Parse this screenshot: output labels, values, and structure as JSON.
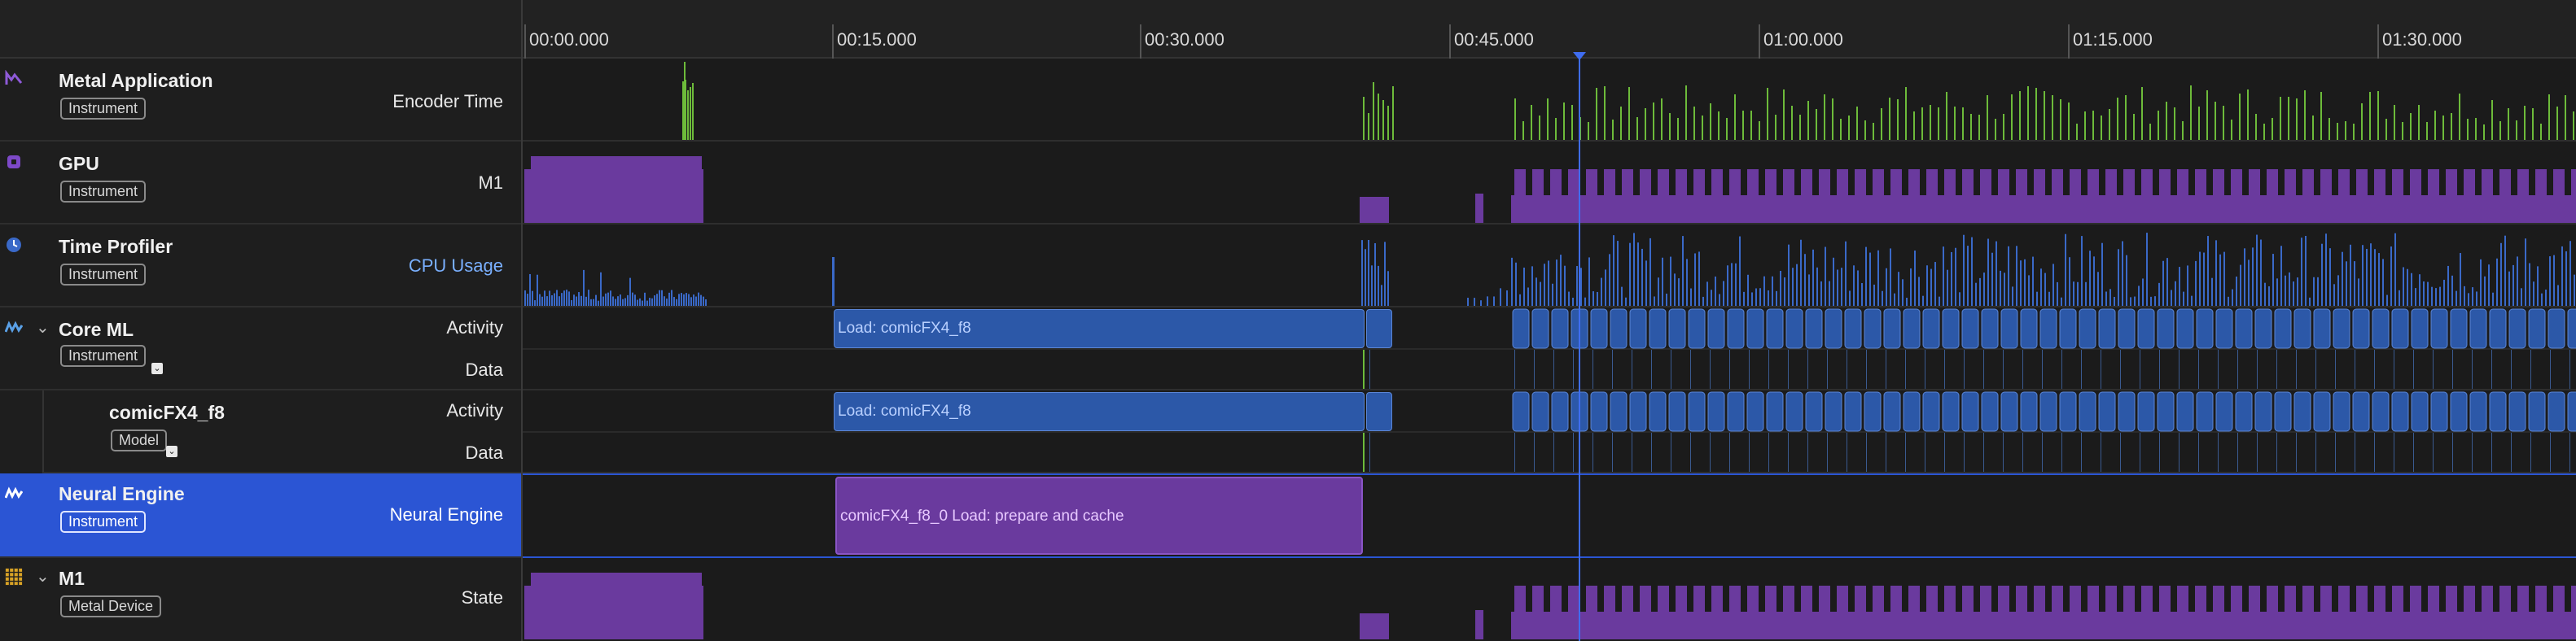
{
  "sidebar": {
    "rows": [
      {
        "title": "Metal Application",
        "badge": "Instrument",
        "right": "Encoder Time",
        "icon": "metal-app-icon"
      },
      {
        "title": "GPU",
        "badge": "Instrument",
        "right": "M1",
        "icon": "gpu-icon"
      },
      {
        "title": "Time Profiler",
        "badge": "Instrument",
        "right": "CPU Usage",
        "icon": "time-profiler-icon"
      },
      {
        "title": "Core ML",
        "badge": "Instrument",
        "right_top": "Activity",
        "right_bottom": "Data",
        "icon": "core-ml-icon"
      },
      {
        "title": "comicFX4_f8",
        "badge": "Model",
        "right_top": "Activity",
        "right_bottom": "Data"
      },
      {
        "title": "Neural Engine",
        "badge": "Instrument",
        "right": "Neural Engine",
        "icon": "neural-engine-icon"
      },
      {
        "title": "M1",
        "badge": "Metal Device",
        "right": "State",
        "icon": "metal-device-icon"
      }
    ]
  },
  "ruler": {
    "ticks": [
      "00:00.000",
      "00:15.000",
      "00:30.000",
      "00:45.000",
      "01:00.000",
      "01:15.000",
      "01:30.000"
    ]
  },
  "lanes": {
    "core_ml_activity_label": "Load: comicFX4_f8",
    "model_activity_label": "Load: comicFX4_f8",
    "neural_engine_label": "comicFX4_f8_0 Load: prepare and cache"
  },
  "colors": {
    "encoder_green": "#6dbb3a",
    "gpu_purple": "#6a3a9e",
    "cpu_blue": "#3a69c8",
    "activity_blue": "#2c58a8",
    "selection_blue": "#2b55d4"
  }
}
